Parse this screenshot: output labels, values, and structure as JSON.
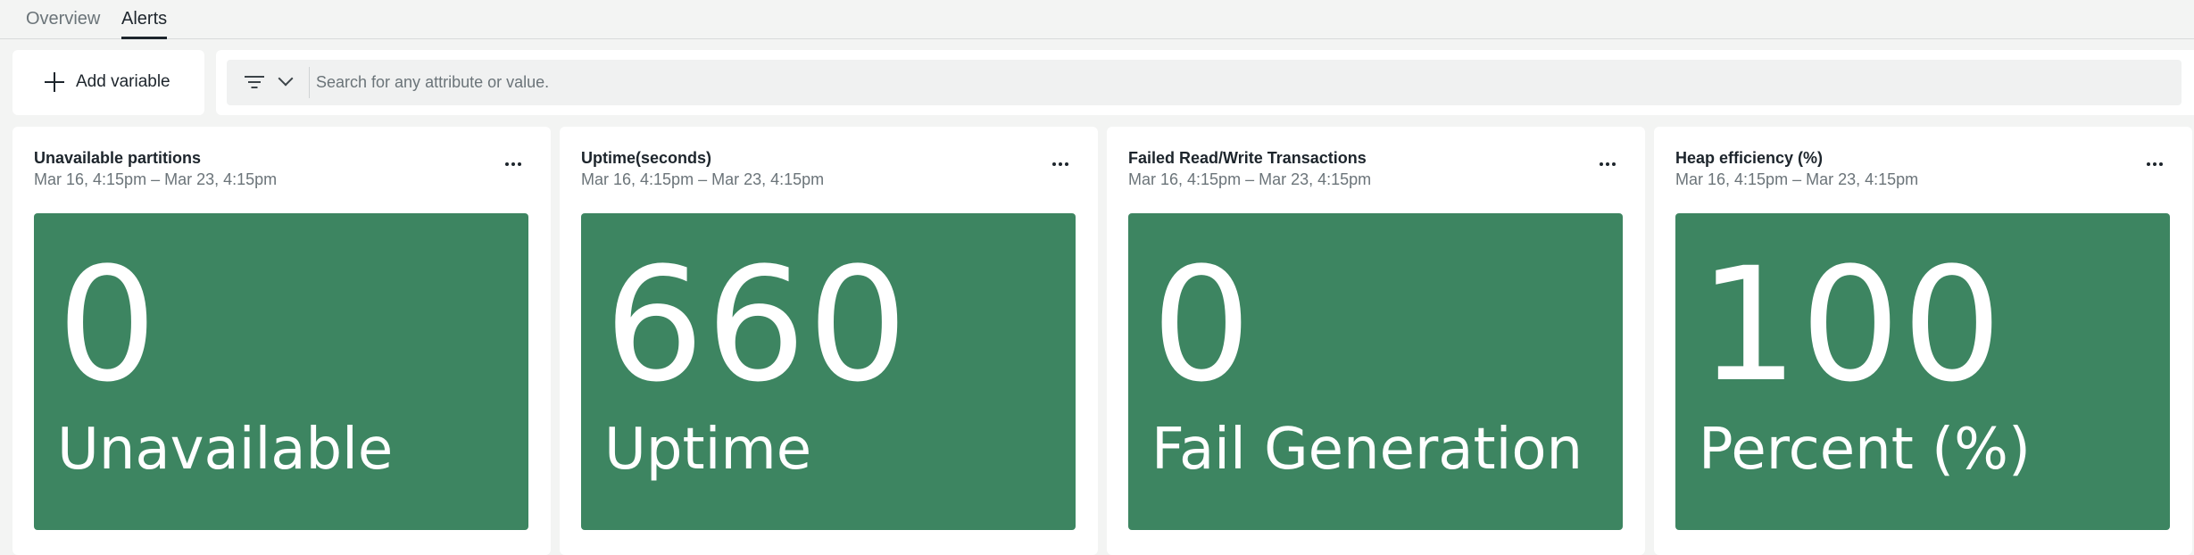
{
  "tabs": [
    {
      "label": "Overview",
      "active": false
    },
    {
      "label": "Alerts",
      "active": true
    }
  ],
  "toolbar": {
    "add_variable_label": "Add variable",
    "search_placeholder": "Search for any attribute or value."
  },
  "colors": {
    "billboard_green": "#3d8561",
    "background": "#f3f4f3"
  },
  "cards": [
    {
      "title": "Unavailable partitions",
      "time_range": "Mar 16, 4:15pm – Mar 23, 4:15pm",
      "value": "0",
      "label": "Unavailable"
    },
    {
      "title": "Uptime(seconds)",
      "time_range": "Mar 16, 4:15pm – Mar 23, 4:15pm",
      "value": "660",
      "label": "Uptime"
    },
    {
      "title": "Failed Read/Write Transactions",
      "time_range": "Mar 16, 4:15pm – Mar 23, 4:15pm",
      "value": "0",
      "label": "Fail Generation"
    },
    {
      "title": "Heap efficiency (%)",
      "time_range": "Mar 16, 4:15pm – Mar 23, 4:15pm",
      "value": "100",
      "label": "Percent (%)"
    }
  ]
}
